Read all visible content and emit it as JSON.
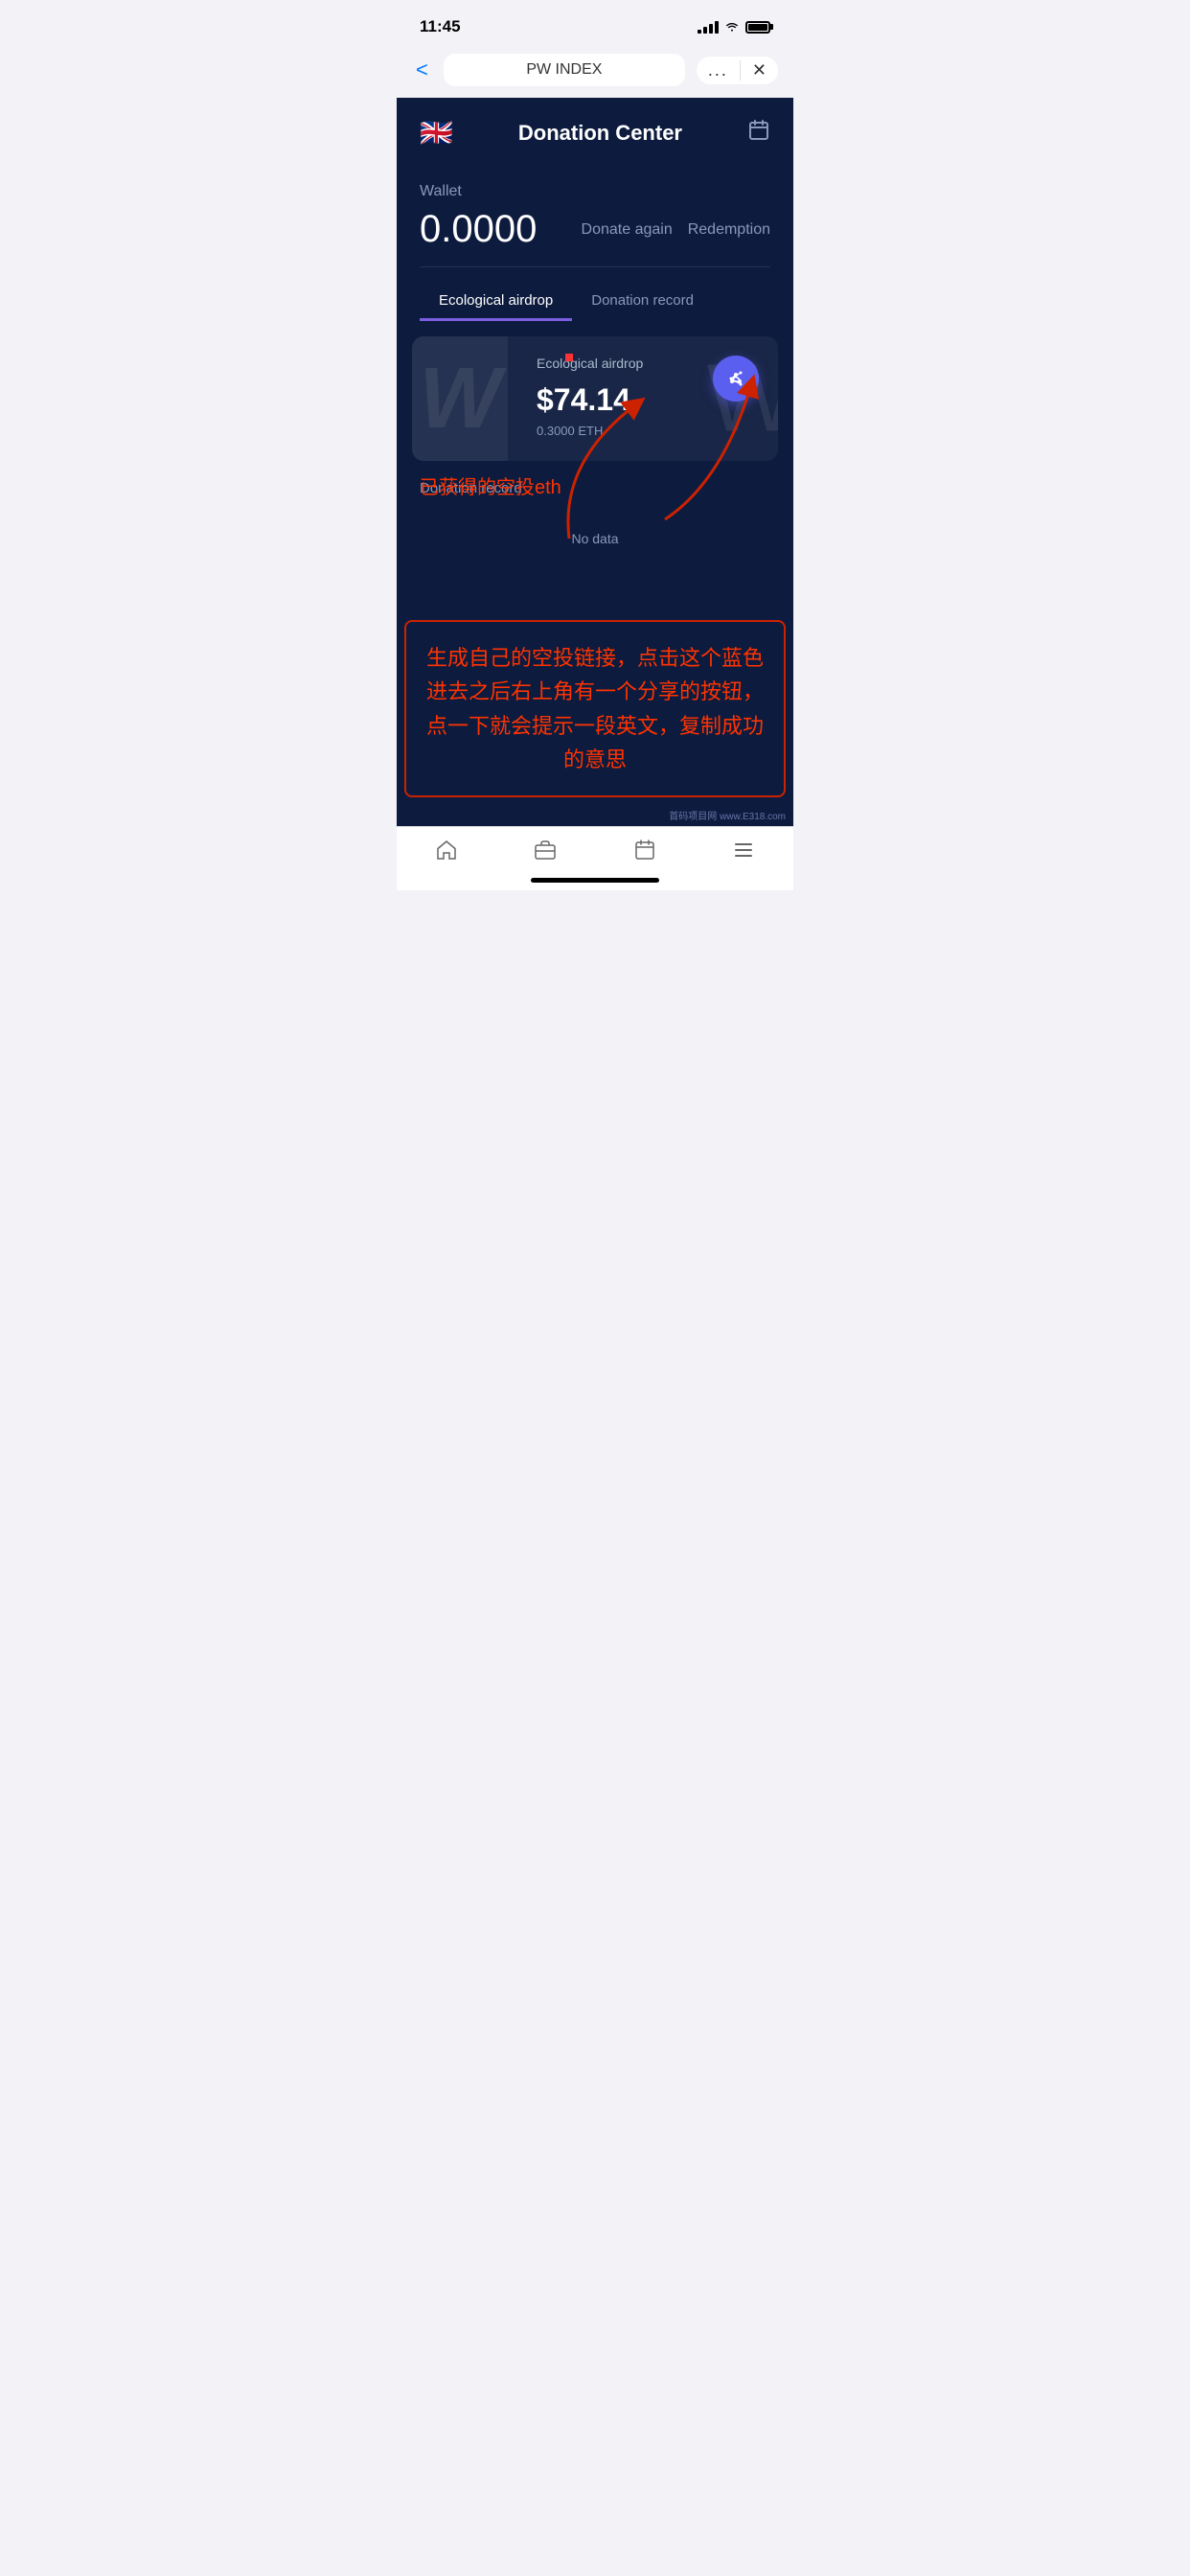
{
  "statusBar": {
    "time": "11:45"
  },
  "browserNav": {
    "backLabel": "<",
    "pageTitle": "PW INDEX",
    "dotsLabel": "...",
    "closeLabel": "✕"
  },
  "appHeader": {
    "flagEmoji": "🇬🇧",
    "title": "Donation Center",
    "calendarIcon": "calendar-icon"
  },
  "walletSection": {
    "label": "Wallet",
    "amount": "0.0000",
    "donateAgainBtn": "Donate again",
    "redemptionBtn": "Redemption"
  },
  "tabs": [
    {
      "label": "Ecological airdrop",
      "active": true
    },
    {
      "label": "Donation record",
      "active": false
    }
  ],
  "airdropCard": {
    "title": "Ecological airdrop",
    "amount": "$74.14",
    "ethAmount": "0.3000 ETH",
    "actionIcon": "share-network-icon"
  },
  "donationSection": {
    "label": "Donation record",
    "noDataText": "No data"
  },
  "annotation": {
    "chineseText": "生成自己的空投链接，点击这个蓝色 进去之后右上角有一个分享的按钮，点一下就会提示一段英文，复制成功的意思",
    "airdropLabel": "已获得的空投eth"
  },
  "bottomTabs": {
    "homeIcon": "🏠",
    "briefcaseIcon": "💼",
    "calendarIcon": "📅",
    "menuIcon": "☰"
  },
  "websiteLabel": "首码项目网 www.E318.com"
}
